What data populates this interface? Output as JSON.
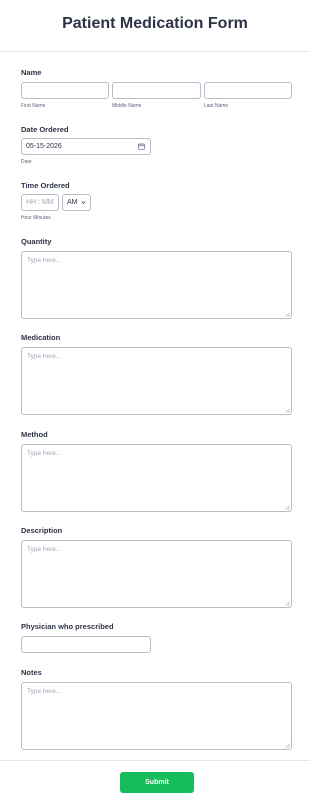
{
  "form": {
    "title": "Patient Medication Form",
    "name": {
      "label": "Name",
      "first_label": "First Name",
      "middle_label": "Middle Name",
      "last_label": "Last Name"
    },
    "date": {
      "label": "Date Ordered",
      "value": "05-15-2026",
      "sublabel": "Date",
      "icon": "calendar-icon"
    },
    "time": {
      "label": "Time Ordered",
      "placeholder": "HH : MM",
      "ampm_value": "AM",
      "sublabel": "Hour Minutes"
    },
    "quantity": {
      "label": "Quantity",
      "placeholder": "Type here..."
    },
    "medication": {
      "label": "Medication",
      "placeholder": "Type here..."
    },
    "method": {
      "label": "Method",
      "placeholder": "Type here..."
    },
    "description": {
      "label": "Description",
      "placeholder": "Type here..."
    },
    "physician": {
      "label": "Physician who prescribed"
    },
    "notes": {
      "label": "Notes",
      "placeholder": "Type here..."
    },
    "submit_label": "Submit"
  },
  "colors": {
    "title": "#2c3345",
    "border": "#b8bdc9",
    "submit": "#18bd5b",
    "placeholder": "#a0a6b4"
  }
}
